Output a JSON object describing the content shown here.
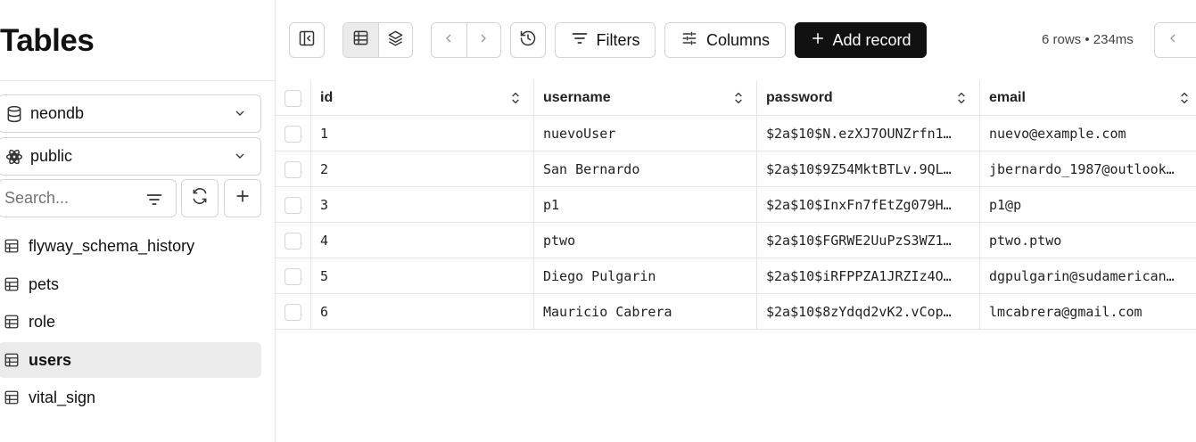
{
  "sidebar": {
    "title": "Tables",
    "database": "neondb",
    "schema": "public",
    "search_placeholder": "Search...",
    "tables": [
      {
        "label": "flyway_schema_history"
      },
      {
        "label": "pets"
      },
      {
        "label": "role"
      },
      {
        "label": "users"
      },
      {
        "label": "vital_sign"
      }
    ]
  },
  "toolbar": {
    "filters_label": "Filters",
    "columns_label": "Columns",
    "add_record_label": "Add record",
    "row_info": "6 rows • 234ms"
  },
  "grid": {
    "columns": [
      "id",
      "username",
      "password",
      "email"
    ],
    "rows": [
      {
        "id": "1",
        "username": "nuevoUser",
        "password": "$2a$10$N.ezXJ7OUNZrfn1…",
        "email": "nuevo@example.com"
      },
      {
        "id": "2",
        "username": "San Bernardo",
        "password": "$2a$10$9Z54MktBTLv.9QL…",
        "email": "jbernardo_1987@outlook…"
      },
      {
        "id": "3",
        "username": "p1",
        "password": "$2a$10$InxFn7fEtZg079H…",
        "email": "p1@p"
      },
      {
        "id": "4",
        "username": "ptwo",
        "password": "$2a$10$FGRWE2UuPzS3WZ1…",
        "email": "ptwo.ptwo"
      },
      {
        "id": "5",
        "username": "Diego Pulgarin",
        "password": "$2a$10$iRFPPZA1JRZIz4O…",
        "email": "dgpulgarin@sudamerican…"
      },
      {
        "id": "6",
        "username": "Mauricio Cabrera",
        "password": "$2a$10$8zYdqd2vK2.vCop…",
        "email": "lmcabrera@gmail.com"
      }
    ]
  },
  "colors": {
    "accent": "#111111",
    "border": "#d4d4d4",
    "active_bg": "#ebebeb"
  }
}
